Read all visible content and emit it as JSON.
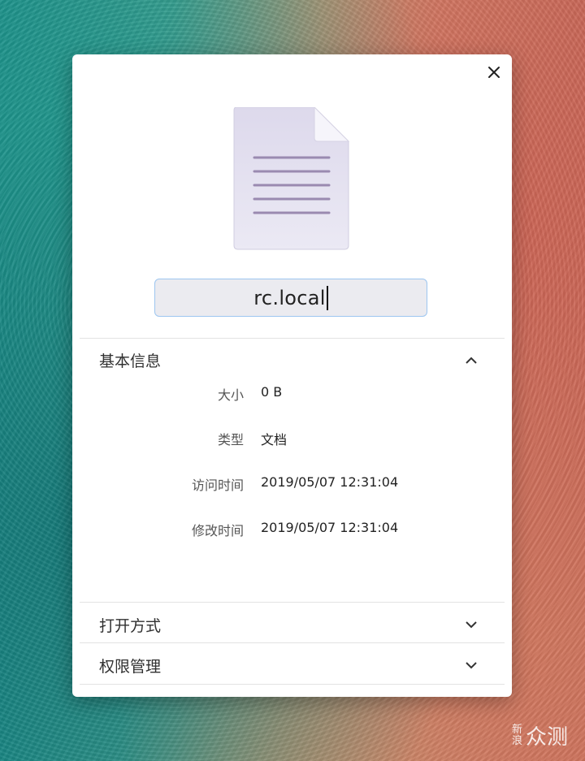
{
  "dialog": {
    "file_name": "rc.local",
    "file_icon": "text-document-icon",
    "close_icon": "close-icon"
  },
  "basic_info": {
    "title": "基本信息",
    "expanded": true,
    "rows": [
      {
        "label": "大小",
        "value": "0 B"
      },
      {
        "label": "类型",
        "value": "文档"
      },
      {
        "label": "访问时间",
        "value": "2019/05/07 12:31:04"
      },
      {
        "label": "修改时间",
        "value": "2019/05/07 12:31:04"
      }
    ]
  },
  "open_with": {
    "title": "打开方式",
    "expanded": false
  },
  "permissions": {
    "title": "权限管理",
    "expanded": false
  },
  "watermark": {
    "small": "新浪",
    "big": "众测"
  },
  "colors": {
    "field_border": "#9dc6f0",
    "field_bg": "#ebebf0",
    "icon_lines": "#9a8ab0"
  }
}
